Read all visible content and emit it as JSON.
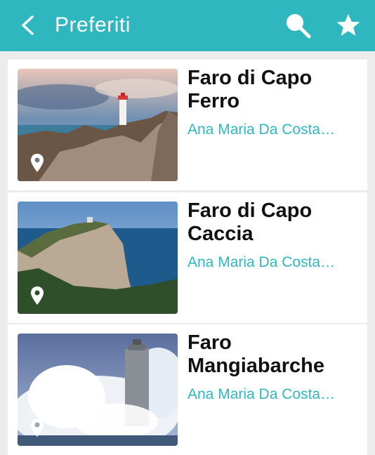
{
  "header": {
    "title": "Preferiti",
    "back_icon": "back-chevron-icon",
    "search_icon": "search-icon",
    "star_icon": "star-icon",
    "background": "#2fb7c0"
  },
  "favorites": [
    {
      "title_line1": "Faro di Capo",
      "title_line2": "Ferro",
      "author": "Ana Maria Da Costa…"
    },
    {
      "title_line1": "Faro di Capo",
      "title_line2": "Caccia",
      "author": "Ana Maria Da Costa…"
    },
    {
      "title_line1": "Faro",
      "title_line2": "Mangiabarche",
      "author": "Ana Maria Da Costa…"
    }
  ]
}
